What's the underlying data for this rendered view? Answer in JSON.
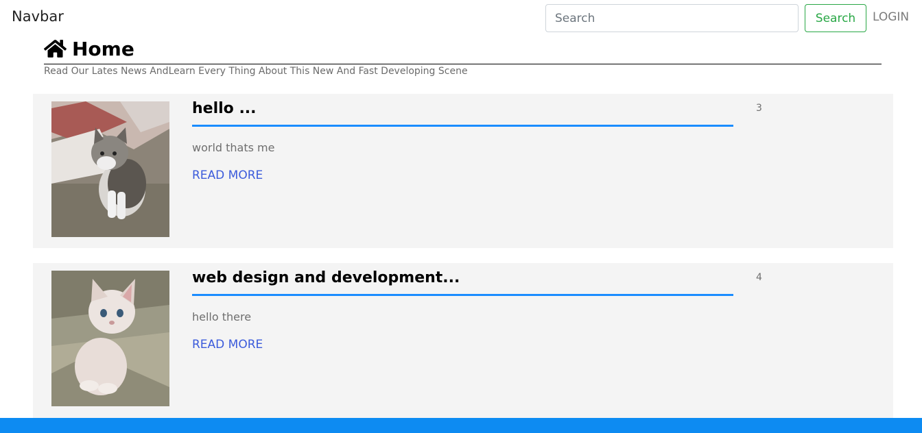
{
  "navbar": {
    "brand": "Navbar",
    "search": {
      "placeholder": "Search",
      "value": ""
    },
    "search_button": "Search",
    "login": "LOGIN"
  },
  "header": {
    "icon": "home-icon",
    "title": "Home",
    "subtitle": "Read Our Lates News AndLearn Every Thing About This New And Fast Developing Scene"
  },
  "posts": [
    {
      "title": "hello ...",
      "excerpt": "world thats me",
      "read_more": "READ MORE",
      "id": "3",
      "image": "tabby-kitten-photo"
    },
    {
      "title": "web design and development...",
      "excerpt": "hello there",
      "read_more": "READ MORE",
      "id": "4",
      "image": "cream-kitten-photo"
    }
  ],
  "colors": {
    "accent": "#1a8cff",
    "footer": "#0d8bf2",
    "search_button": "#28a745",
    "link": "#3b5bdb",
    "card_bg": "#f4f4f4"
  }
}
